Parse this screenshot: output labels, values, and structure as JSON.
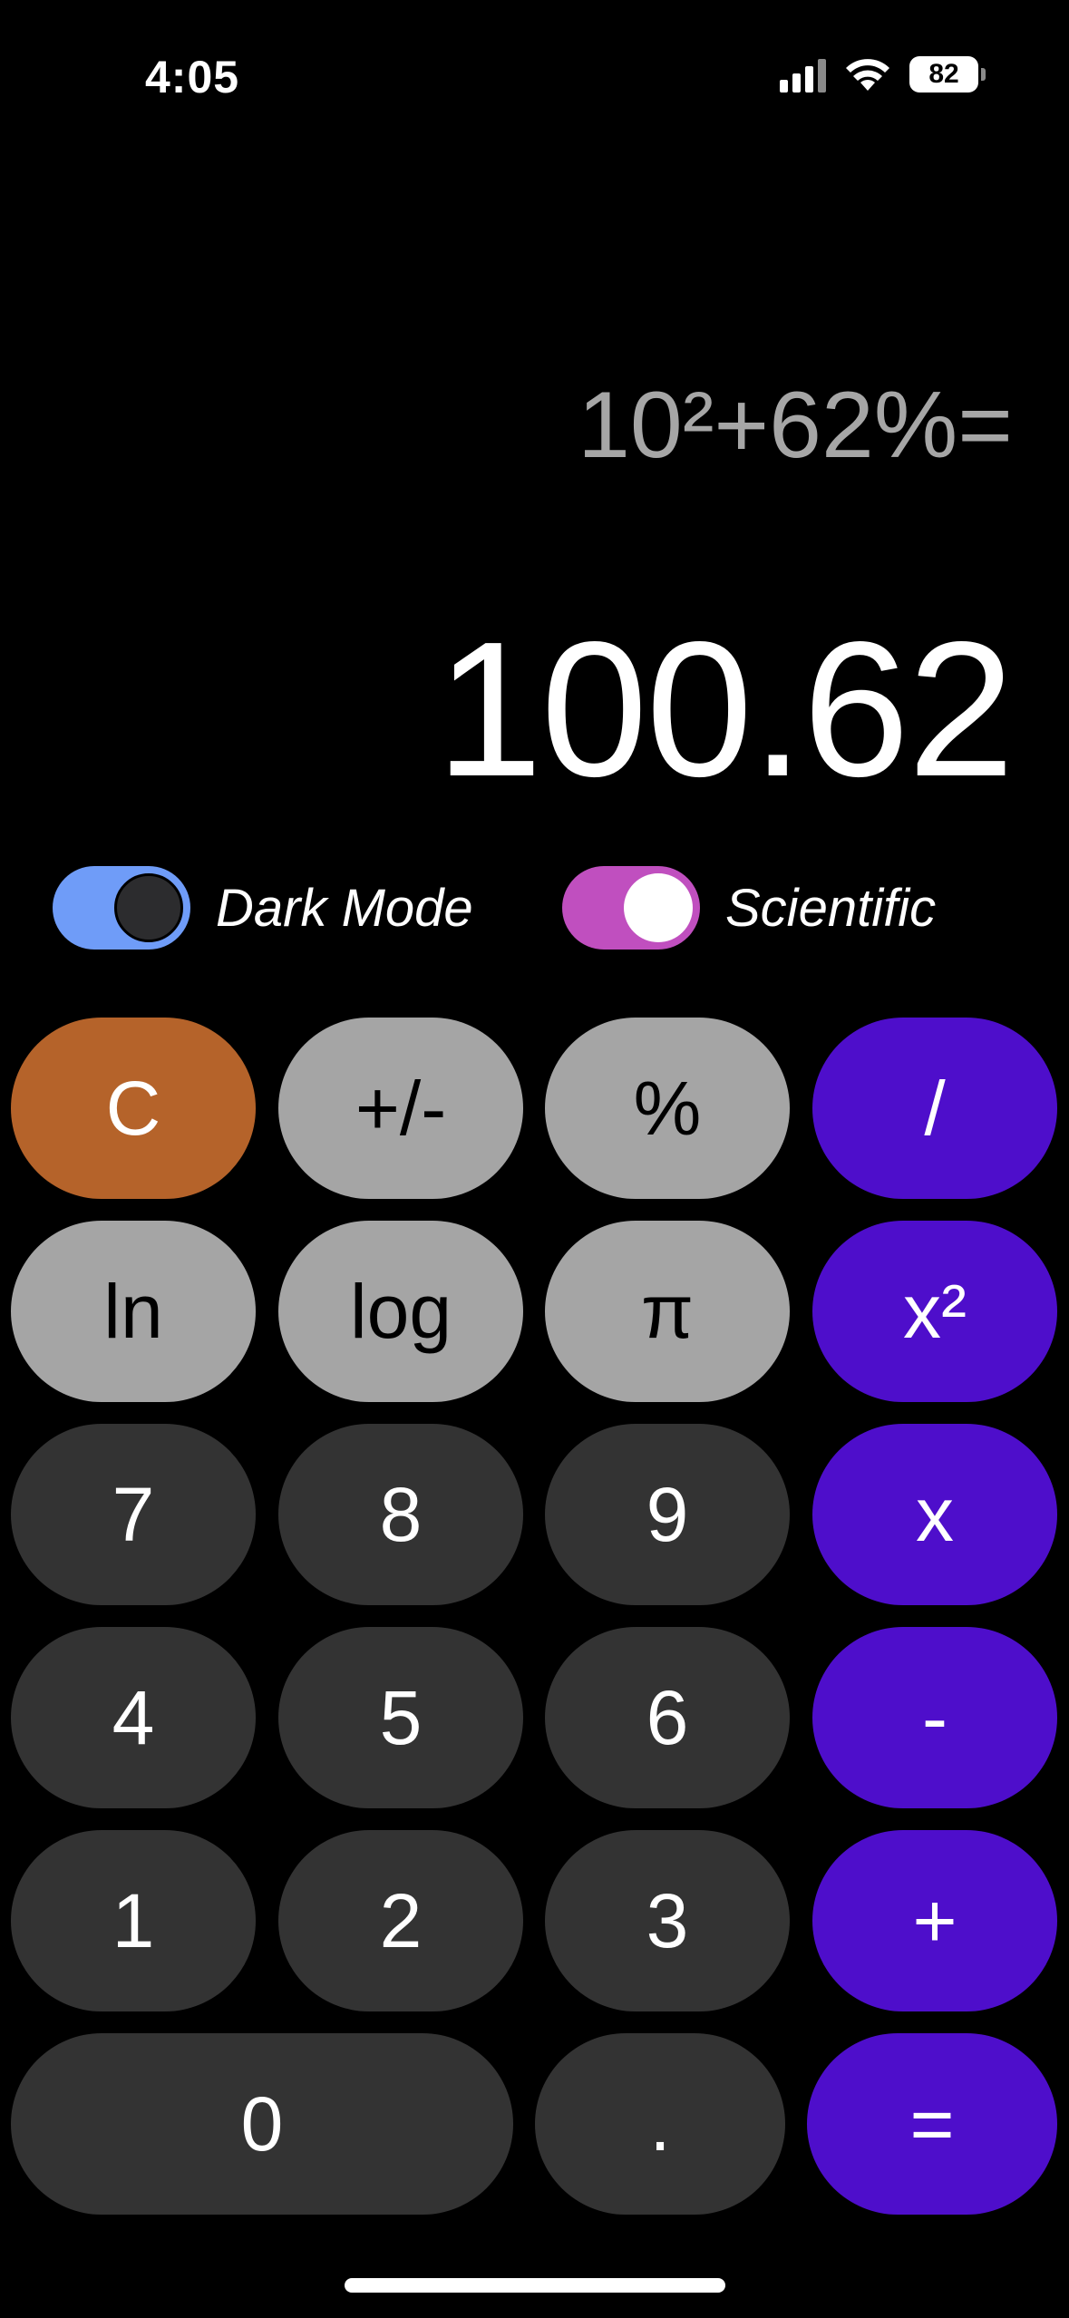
{
  "status_bar": {
    "time": "4:05",
    "battery": "82",
    "icons": [
      "signal-icon",
      "wifi-icon",
      "battery-icon"
    ]
  },
  "display": {
    "expression": "10²+62%=",
    "result": "100.62"
  },
  "toggles": {
    "dark_mode": {
      "label": "Dark Mode",
      "on": true,
      "color": "#6f9cf8"
    },
    "scientific": {
      "label": "Scientific",
      "on": true,
      "color": "#c04fbf"
    }
  },
  "colors": {
    "clear": "#b5632a",
    "function": "#a5a5a5",
    "digit": "#333333",
    "operator": "#4e0ecb"
  },
  "keypad": {
    "clear": "C",
    "plus_minus": "+/-",
    "percent": "%",
    "divide": "/",
    "ln": "ln",
    "log": "log",
    "pi": "π",
    "square": "x²",
    "seven": "7",
    "eight": "8",
    "nine": "9",
    "multiply": "x",
    "four": "4",
    "five": "5",
    "six": "6",
    "minus": "-",
    "one": "1",
    "two": "2",
    "three": "3",
    "plus": "+",
    "zero": "0",
    "decimal": ".",
    "equals": "="
  }
}
